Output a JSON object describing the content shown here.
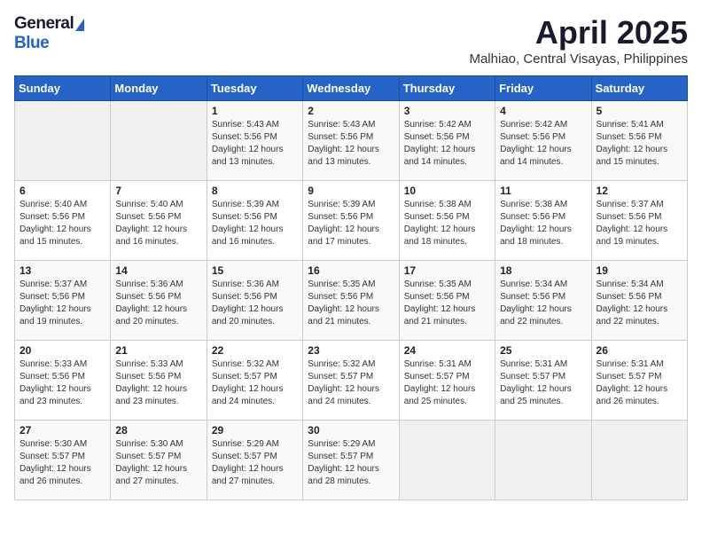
{
  "header": {
    "logo_general": "General",
    "logo_blue": "Blue",
    "month": "April 2025",
    "subtitle": "Malhiao, Central Visayas, Philippines"
  },
  "weekdays": [
    "Sunday",
    "Monday",
    "Tuesday",
    "Wednesday",
    "Thursday",
    "Friday",
    "Saturday"
  ],
  "weeks": [
    [
      {
        "day": "",
        "sunrise": "",
        "sunset": "",
        "daylight": "",
        "empty": true
      },
      {
        "day": "",
        "sunrise": "",
        "sunset": "",
        "daylight": "",
        "empty": true
      },
      {
        "day": "1",
        "sunrise": "Sunrise: 5:43 AM",
        "sunset": "Sunset: 5:56 PM",
        "daylight": "Daylight: 12 hours and 13 minutes."
      },
      {
        "day": "2",
        "sunrise": "Sunrise: 5:43 AM",
        "sunset": "Sunset: 5:56 PM",
        "daylight": "Daylight: 12 hours and 13 minutes."
      },
      {
        "day": "3",
        "sunrise": "Sunrise: 5:42 AM",
        "sunset": "Sunset: 5:56 PM",
        "daylight": "Daylight: 12 hours and 14 minutes."
      },
      {
        "day": "4",
        "sunrise": "Sunrise: 5:42 AM",
        "sunset": "Sunset: 5:56 PM",
        "daylight": "Daylight: 12 hours and 14 minutes."
      },
      {
        "day": "5",
        "sunrise": "Sunrise: 5:41 AM",
        "sunset": "Sunset: 5:56 PM",
        "daylight": "Daylight: 12 hours and 15 minutes."
      }
    ],
    [
      {
        "day": "6",
        "sunrise": "Sunrise: 5:40 AM",
        "sunset": "Sunset: 5:56 PM",
        "daylight": "Daylight: 12 hours and 15 minutes."
      },
      {
        "day": "7",
        "sunrise": "Sunrise: 5:40 AM",
        "sunset": "Sunset: 5:56 PM",
        "daylight": "Daylight: 12 hours and 16 minutes."
      },
      {
        "day": "8",
        "sunrise": "Sunrise: 5:39 AM",
        "sunset": "Sunset: 5:56 PM",
        "daylight": "Daylight: 12 hours and 16 minutes."
      },
      {
        "day": "9",
        "sunrise": "Sunrise: 5:39 AM",
        "sunset": "Sunset: 5:56 PM",
        "daylight": "Daylight: 12 hours and 17 minutes."
      },
      {
        "day": "10",
        "sunrise": "Sunrise: 5:38 AM",
        "sunset": "Sunset: 5:56 PM",
        "daylight": "Daylight: 12 hours and 18 minutes."
      },
      {
        "day": "11",
        "sunrise": "Sunrise: 5:38 AM",
        "sunset": "Sunset: 5:56 PM",
        "daylight": "Daylight: 12 hours and 18 minutes."
      },
      {
        "day": "12",
        "sunrise": "Sunrise: 5:37 AM",
        "sunset": "Sunset: 5:56 PM",
        "daylight": "Daylight: 12 hours and 19 minutes."
      }
    ],
    [
      {
        "day": "13",
        "sunrise": "Sunrise: 5:37 AM",
        "sunset": "Sunset: 5:56 PM",
        "daylight": "Daylight: 12 hours and 19 minutes."
      },
      {
        "day": "14",
        "sunrise": "Sunrise: 5:36 AM",
        "sunset": "Sunset: 5:56 PM",
        "daylight": "Daylight: 12 hours and 20 minutes."
      },
      {
        "day": "15",
        "sunrise": "Sunrise: 5:36 AM",
        "sunset": "Sunset: 5:56 PM",
        "daylight": "Daylight: 12 hours and 20 minutes."
      },
      {
        "day": "16",
        "sunrise": "Sunrise: 5:35 AM",
        "sunset": "Sunset: 5:56 PM",
        "daylight": "Daylight: 12 hours and 21 minutes."
      },
      {
        "day": "17",
        "sunrise": "Sunrise: 5:35 AM",
        "sunset": "Sunset: 5:56 PM",
        "daylight": "Daylight: 12 hours and 21 minutes."
      },
      {
        "day": "18",
        "sunrise": "Sunrise: 5:34 AM",
        "sunset": "Sunset: 5:56 PM",
        "daylight": "Daylight: 12 hours and 22 minutes."
      },
      {
        "day": "19",
        "sunrise": "Sunrise: 5:34 AM",
        "sunset": "Sunset: 5:56 PM",
        "daylight": "Daylight: 12 hours and 22 minutes."
      }
    ],
    [
      {
        "day": "20",
        "sunrise": "Sunrise: 5:33 AM",
        "sunset": "Sunset: 5:56 PM",
        "daylight": "Daylight: 12 hours and 23 minutes."
      },
      {
        "day": "21",
        "sunrise": "Sunrise: 5:33 AM",
        "sunset": "Sunset: 5:56 PM",
        "daylight": "Daylight: 12 hours and 23 minutes."
      },
      {
        "day": "22",
        "sunrise": "Sunrise: 5:32 AM",
        "sunset": "Sunset: 5:57 PM",
        "daylight": "Daylight: 12 hours and 24 minutes."
      },
      {
        "day": "23",
        "sunrise": "Sunrise: 5:32 AM",
        "sunset": "Sunset: 5:57 PM",
        "daylight": "Daylight: 12 hours and 24 minutes."
      },
      {
        "day": "24",
        "sunrise": "Sunrise: 5:31 AM",
        "sunset": "Sunset: 5:57 PM",
        "daylight": "Daylight: 12 hours and 25 minutes."
      },
      {
        "day": "25",
        "sunrise": "Sunrise: 5:31 AM",
        "sunset": "Sunset: 5:57 PM",
        "daylight": "Daylight: 12 hours and 25 minutes."
      },
      {
        "day": "26",
        "sunrise": "Sunrise: 5:31 AM",
        "sunset": "Sunset: 5:57 PM",
        "daylight": "Daylight: 12 hours and 26 minutes."
      }
    ],
    [
      {
        "day": "27",
        "sunrise": "Sunrise: 5:30 AM",
        "sunset": "Sunset: 5:57 PM",
        "daylight": "Daylight: 12 hours and 26 minutes."
      },
      {
        "day": "28",
        "sunrise": "Sunrise: 5:30 AM",
        "sunset": "Sunset: 5:57 PM",
        "daylight": "Daylight: 12 hours and 27 minutes."
      },
      {
        "day": "29",
        "sunrise": "Sunrise: 5:29 AM",
        "sunset": "Sunset: 5:57 PM",
        "daylight": "Daylight: 12 hours and 27 minutes."
      },
      {
        "day": "30",
        "sunrise": "Sunrise: 5:29 AM",
        "sunset": "Sunset: 5:57 PM",
        "daylight": "Daylight: 12 hours and 28 minutes."
      },
      {
        "day": "",
        "sunrise": "",
        "sunset": "",
        "daylight": "",
        "empty": true
      },
      {
        "day": "",
        "sunrise": "",
        "sunset": "",
        "daylight": "",
        "empty": true
      },
      {
        "day": "",
        "sunrise": "",
        "sunset": "",
        "daylight": "",
        "empty": true
      }
    ]
  ]
}
